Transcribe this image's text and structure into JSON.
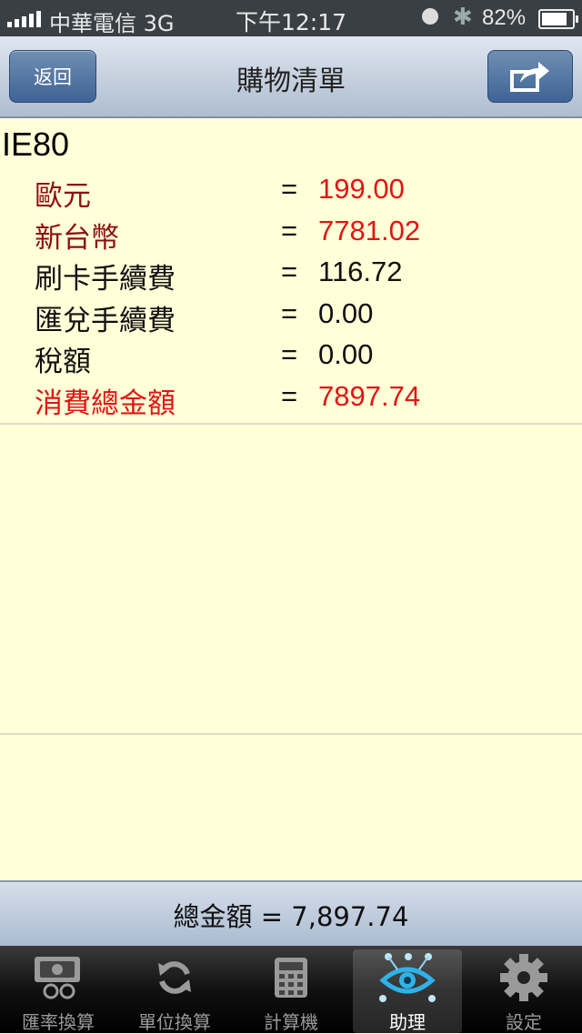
{
  "status_bar": {
    "carrier": "中華電信 3G",
    "time": "下午12:17",
    "battery": "82%"
  },
  "nav": {
    "back_label": "返回",
    "title": "購物清單",
    "share_icon": "share-icon"
  },
  "item": {
    "name": "IE80",
    "rows": [
      {
        "label": "歐元",
        "eq": "=",
        "value": "199.00",
        "color": "#8b1010",
        "value_color": "#e01515"
      },
      {
        "label": "新台幣",
        "eq": "=",
        "value": "7781.02",
        "color": "#8b1010",
        "value_color": "#e01515"
      },
      {
        "label": "刷卡手續費",
        "eq": "=",
        "value": "116.72",
        "color": "#111111",
        "value_color": "#111111"
      },
      {
        "label": "匯兌手續費",
        "eq": "=",
        "value": "0.00",
        "color": "#111111",
        "value_color": "#111111"
      },
      {
        "label": "稅額",
        "eq": "=",
        "value": "0.00",
        "color": "#111111",
        "value_color": "#111111"
      },
      {
        "label": "消費總金額",
        "eq": "=",
        "value": "7897.74",
        "color": "#e01515",
        "value_color": "#e01515"
      }
    ]
  },
  "total": {
    "text": "總金額 = 7,897.74"
  },
  "tabs": [
    {
      "label": "匯率換算",
      "icon": "currency-exchange-icon",
      "selected": false
    },
    {
      "label": "單位換算",
      "icon": "refresh-icon",
      "selected": false
    },
    {
      "label": "計算機",
      "icon": "calculator-icon",
      "selected": false
    },
    {
      "label": "助理",
      "icon": "assistant-eye-icon",
      "selected": true
    },
    {
      "label": "設定",
      "icon": "gear-icon",
      "selected": false
    }
  ]
}
